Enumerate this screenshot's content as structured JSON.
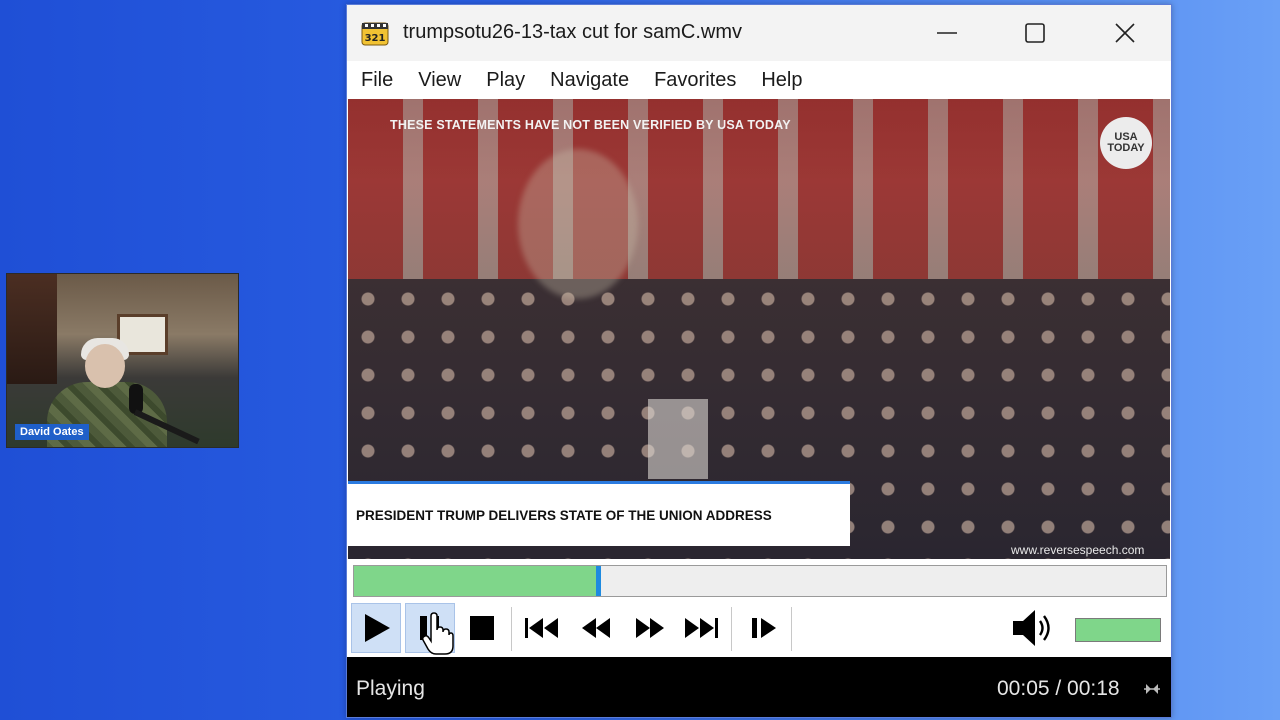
{
  "webcam": {
    "name": "David Oates"
  },
  "window": {
    "title": "trumpsotu26-13-tax cut for samC.wmv",
    "minimize_icon": "minimize-icon",
    "maximize_icon": "maximize-icon",
    "close_icon": "close-icon"
  },
  "menu": {
    "items": [
      "File",
      "View",
      "Play",
      "Navigate",
      "Favorites",
      "Help"
    ]
  },
  "video": {
    "disclaimer": "THESE STATEMENTS HAVE NOT BEEN VERIFIED BY USA TODAY",
    "logo_line1": "USA",
    "logo_line2": "TODAY",
    "lower_third": "PRESIDENT TRUMP DELIVERS STATE OF THE UNION ADDRESS",
    "watermark": "www.reversespeech.com"
  },
  "seek": {
    "progress_fraction": 0.3,
    "fill_color": "#7fd68a",
    "thumb_color": "#1e8ae0"
  },
  "controls": {
    "buttons": [
      "play-icon",
      "pause-icon",
      "stop-icon",
      "skip-back-icon",
      "rewind-icon",
      "fast-forward-icon",
      "skip-forward-icon",
      "frame-step-icon"
    ],
    "active": "play-icon"
  },
  "volume": {
    "icon": "speaker-icon",
    "level_fraction": 1.0
  },
  "status": {
    "state": "Playing",
    "time": "00:05 / 00:18",
    "icon": "stream-icon"
  },
  "colors": {
    "desktop_blue": "#2a5fe3",
    "status_bg": "#000000"
  }
}
